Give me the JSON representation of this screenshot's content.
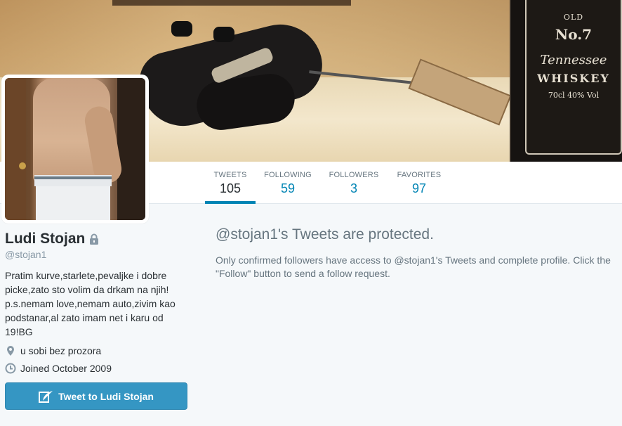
{
  "banner": {
    "description_icon": "header-photo",
    "bottle_label": {
      "line1": "OLD",
      "line2": "No.7",
      "line3": "Tennessee",
      "line4": "WHISKEY",
      "line5": "70cl 40% Vol"
    }
  },
  "nav": {
    "items": [
      {
        "label": "TWEETS",
        "value": "105",
        "active": true
      },
      {
        "label": "FOLLOWING",
        "value": "59",
        "active": false
      },
      {
        "label": "FOLLOWERS",
        "value": "3",
        "active": false
      },
      {
        "label": "FAVORITES",
        "value": "97",
        "active": false
      }
    ]
  },
  "profile": {
    "name": "Ludi Stojan",
    "screen_name": "@stojan1",
    "bio": "Pratim kurve,starlete,pevaljke i dobre picke,zato sto volim da drkam na njih! p.s.nemam love,nemam auto,zivim kao podstanar,al zato imam net i karu od 19!BG",
    "location": "u sobi bez prozora",
    "joined": "Joined October 2009",
    "tweet_button_label": "Tweet to Ludi Stojan",
    "icons": {
      "lock": "lock-icon",
      "location": "location-pin-icon",
      "joined": "clock-icon",
      "tweet": "feather-icon"
    }
  },
  "protected": {
    "title": "@stojan1's Tweets are protected.",
    "message": "Only confirmed followers have access to @stojan1's Tweets and complete profile. Click the \"Follow\" button to send a follow request."
  },
  "colors": {
    "accent": "#0084b4",
    "button": "#3596c3",
    "muted": "#66757f",
    "background": "#f5f8fa"
  }
}
